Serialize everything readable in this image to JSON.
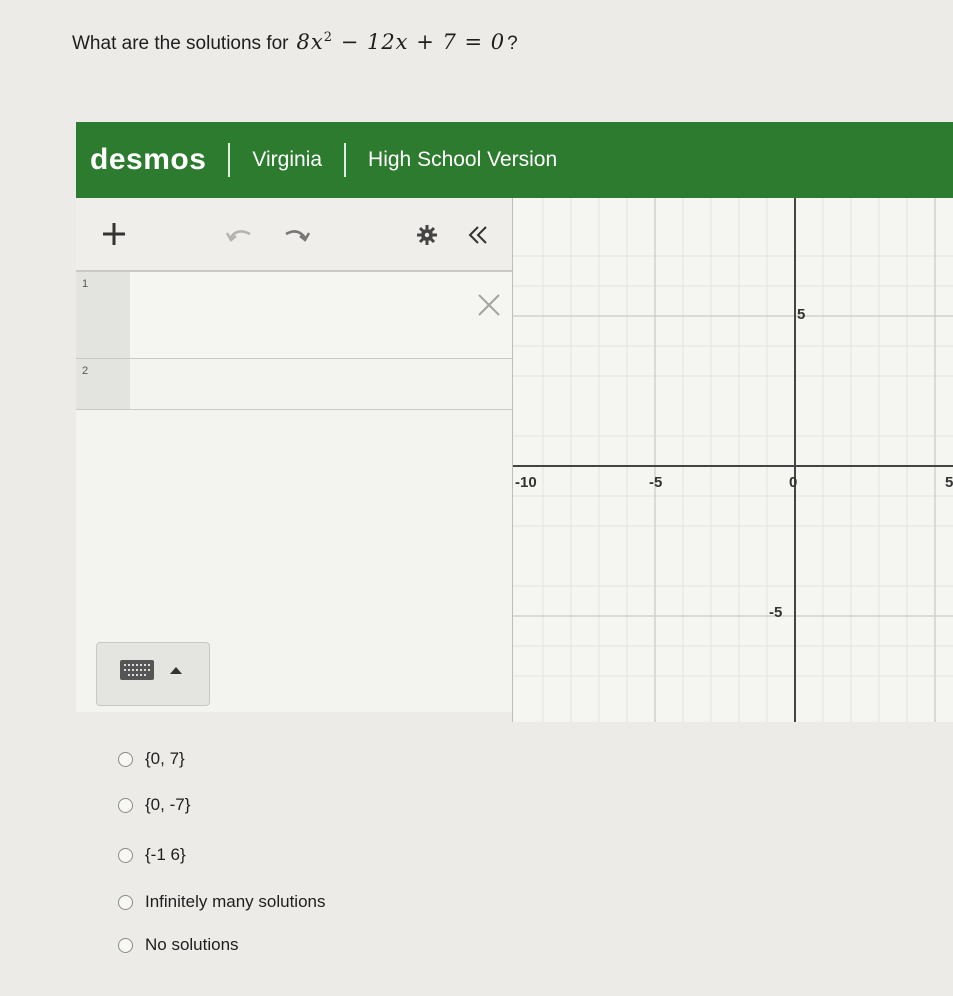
{
  "question": {
    "prefix": "What are the solutions for",
    "equation": {
      "a": "8x",
      "exponent": "2",
      "rest": "− 12x + 7 = 0",
      "suffix": "?"
    }
  },
  "header": {
    "brand": "desmos",
    "region": "Virginia",
    "version": "High School Version"
  },
  "toolbar": {
    "add_icon": "plus-icon",
    "undo_icon": "undo-icon",
    "redo_icon": "redo-icon",
    "settings_icon": "gear-icon",
    "collapse_icon": "double-chevron-left-icon"
  },
  "expressions": [
    {
      "number": "1",
      "value": ""
    },
    {
      "number": "2",
      "value": ""
    }
  ],
  "graph": {
    "x_ticks": [
      "-10",
      "-5",
      "0",
      "5"
    ],
    "y_ticks": [
      "5",
      "-5"
    ]
  },
  "options": [
    {
      "label": "{0, 7}"
    },
    {
      "label": "{0, -7}"
    },
    {
      "label": "{-1 6}"
    },
    {
      "label": "Infinitely many solutions"
    },
    {
      "label": "No solutions"
    }
  ],
  "colors": {
    "header": "#2d7b2f",
    "axis": "#444444",
    "grid": "#d9d9d5"
  }
}
